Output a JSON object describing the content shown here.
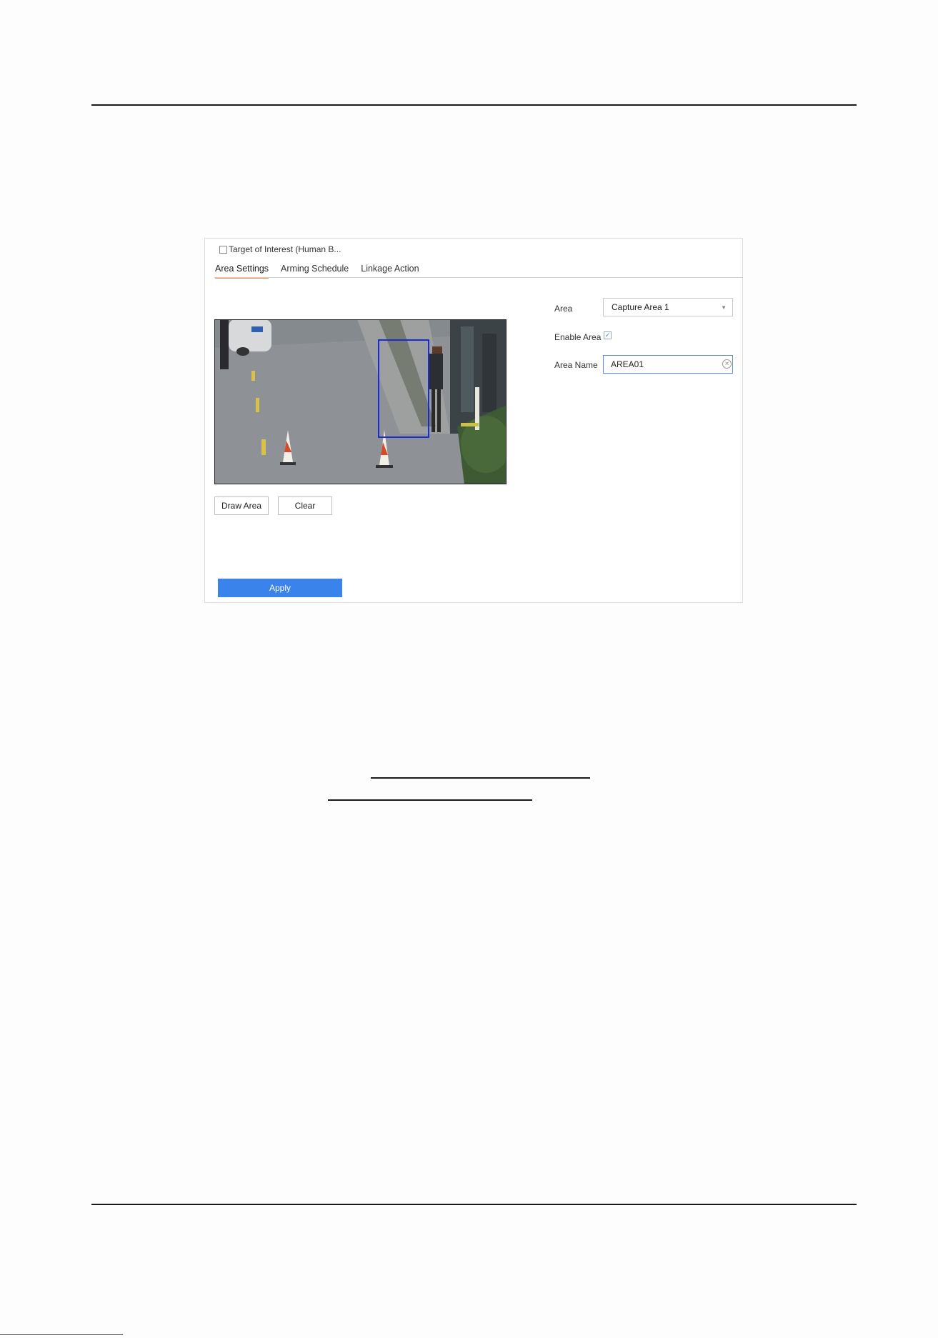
{
  "panel": {
    "target_of_interest_label": "Target of Interest (Human B...",
    "tabs": [
      {
        "label": "Area Settings",
        "active": true
      },
      {
        "label": "Arming Schedule",
        "active": false
      },
      {
        "label": "Linkage Action",
        "active": false
      }
    ],
    "buttons": {
      "draw_area": "Draw Area",
      "clear": "Clear",
      "apply": "Apply"
    },
    "fields": {
      "area_label": "Area",
      "area_value": "Capture Area 1",
      "enable_area_label": "Enable Area",
      "enable_area_checked": true,
      "area_name_label": "Area Name",
      "area_name_value": "AREA01"
    }
  },
  "colors": {
    "accent": "#3a83ea",
    "tab_underline": "#f08a4b",
    "detection_box": "#1a2bd6"
  },
  "icons": [
    "checkbox-icon",
    "chevron-down-icon",
    "check-icon",
    "clear-circle-icon"
  ]
}
